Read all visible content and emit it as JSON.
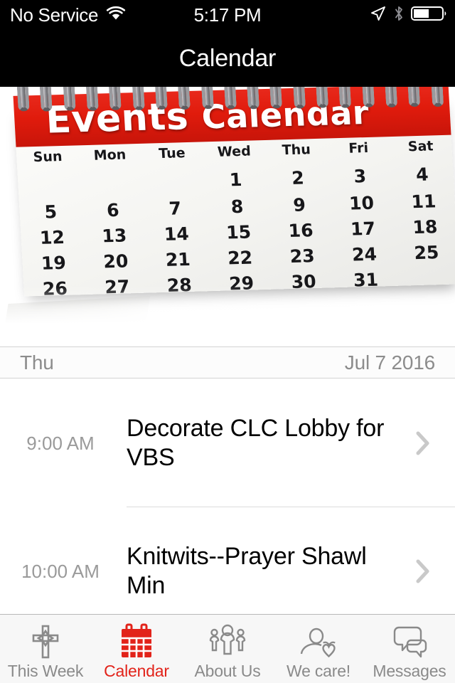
{
  "status_bar": {
    "carrier": "No Service",
    "time": "5:17 PM",
    "icons": [
      "wifi-icon",
      "location-arrow-icon",
      "bluetooth-icon",
      "battery-icon"
    ],
    "battery_level_percent": 52
  },
  "nav": {
    "title": "Calendar"
  },
  "hero": {
    "banner_word1": "Events",
    "banner_word2": "Calendar",
    "day_headers": [
      "Sun",
      "Mon",
      "Tue",
      "Wed",
      "Thu",
      "Fri",
      "Sat"
    ],
    "weeks": [
      [
        "",
        "",
        "",
        "1",
        "2",
        "3",
        "4"
      ],
      [
        "5",
        "6",
        "7",
        "8",
        "9",
        "10",
        "11"
      ],
      [
        "12",
        "13",
        "14",
        "15",
        "16",
        "17",
        "18"
      ],
      [
        "19",
        "20",
        "21",
        "22",
        "23",
        "24",
        "25"
      ],
      [
        "26",
        "27",
        "28",
        "29",
        "30",
        "31",
        ""
      ]
    ]
  },
  "date_bar": {
    "weekday": "Thu",
    "date": "Jul 7 2016"
  },
  "events": [
    {
      "time": "9:00 AM",
      "title": "Decorate CLC Lobby for VBS",
      "chevron": "chevron-right-icon"
    },
    {
      "time": "10:00 AM",
      "title": "Knitwits--Prayer Shawl Min",
      "chevron": "chevron-right-icon"
    }
  ],
  "tabs": [
    {
      "label": "This Week",
      "icon": "cross-icon",
      "active": false
    },
    {
      "label": "Calendar",
      "icon": "calendar-icon",
      "active": true
    },
    {
      "label": "About Us",
      "icon": "people-group-icon",
      "active": false
    },
    {
      "label": "We care!",
      "icon": "person-heart-icon",
      "active": false
    },
    {
      "label": "Messages",
      "icon": "speech-bubbles-icon",
      "active": false
    }
  ],
  "colors": {
    "accent_red": "#e2231a",
    "banner_red": "#e01b0c",
    "nav_black": "#000000",
    "tab_inactive_gray": "#8a8a8a",
    "secondary_text": "#8c8c8c"
  }
}
